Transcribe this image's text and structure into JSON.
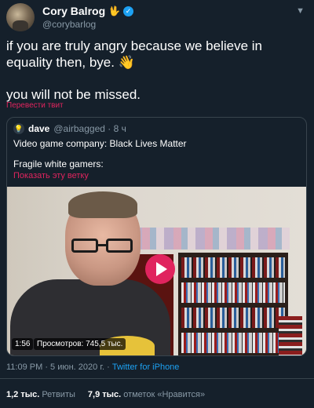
{
  "tweet": {
    "author_name": "Cory Balrog",
    "author_emoji": "🖖",
    "author_handle": "@corybarlog",
    "text_line1": "if you are truly angry because we believe in equality then, bye. 👋",
    "text_line2": "you will not be missed.",
    "translate_link": "Перевести твит",
    "timestamp": "11:09 PM · 5 июн. 2020 г. · ",
    "source": "Twitter for iPhone",
    "retweets_count": "1,2 тыс.",
    "retweets_label": "Ретвиты",
    "likes_count": "7,9 тыс.",
    "likes_label": "отметок «Нравится»"
  },
  "quoted": {
    "avatar_emoji": "💡",
    "name": "dave",
    "handle": "@airbagged · 8 ч",
    "text1": "Video game company: Black Lives Matter",
    "text2": "Fragile white gamers:",
    "thread_link": "Показать эту ветку",
    "video": {
      "duration": "1:56",
      "views": "Просмотров: 745,5 тыс."
    }
  },
  "icons": {
    "verified": "verified-badge-icon",
    "menu": "chevron-down-icon",
    "play": "play-icon"
  },
  "colors": {
    "background": "#15202b",
    "accent_link": "#e0245e",
    "source_link": "#1da1f2",
    "muted": "#8899a6"
  }
}
